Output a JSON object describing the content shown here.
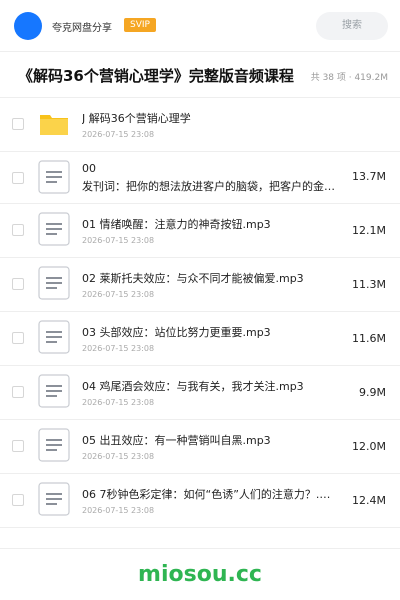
{
  "header": {
    "app_name": "夸克网盘分享",
    "badge": "SVIP",
    "search_placeholder": "搜索"
  },
  "title": {
    "text": "《解码36个营销心理学》完整版音频课程",
    "meta": "共 38 项 · 419.2M"
  },
  "files": [
    {
      "type": "folder-icon",
      "name": "J 解码36个营销心理学",
      "date": "2026-07-15 23:08",
      "size": ""
    },
    {
      "type": "document-icon",
      "name": "00",
      "name2": "发刊词：把你的想法放进客户的脑袋，把客户的金…",
      "date": "",
      "size": "13.7M"
    },
    {
      "type": "document-icon",
      "name": "01 情绪唤醒：注意力的神奇按钮.mp3",
      "date": "2026-07-15 23:08",
      "size": "12.1M"
    },
    {
      "type": "document-icon",
      "name": "02 莱斯托夫效应：与众不同才能被偏爱.mp3",
      "date": "2026-07-15 23:08",
      "size": "11.3M"
    },
    {
      "type": "document-icon",
      "name": "03 头部效应：站位比努力更重要.mp3",
      "date": "2026-07-15 23:08",
      "size": "11.6M"
    },
    {
      "type": "document-icon",
      "name": "04 鸡尾酒会效应：与我有关，我才关注.mp3",
      "date": "2026-07-15 23:08",
      "size": "9.9M"
    },
    {
      "type": "document-icon",
      "name": "05 出丑效应：有一种营销叫自黑.mp3",
      "date": "2026-07-15 23:08",
      "size": "12.0M"
    },
    {
      "type": "document-icon",
      "name": "06 7秒钟色彩定律：如何“色诱”人们的注意力？.…",
      "date": "2026-07-15 23:08",
      "size": "12.4M"
    }
  ],
  "watermark": "miosou.cc",
  "colors": {
    "accent": "#1677ff",
    "badge": "#f5a623",
    "folder": "#f8c21b",
    "watermark": "#2fb552"
  }
}
